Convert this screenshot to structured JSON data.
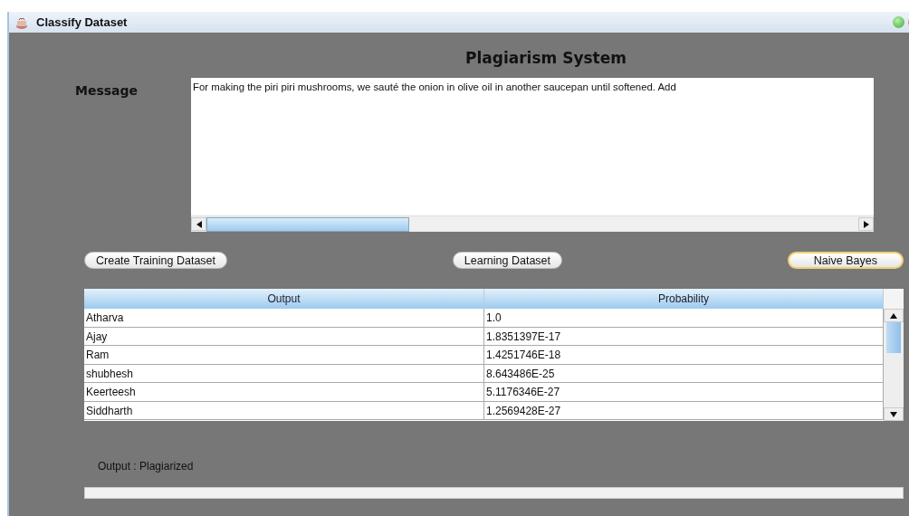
{
  "window": {
    "title": "Classify Dataset"
  },
  "heading": "Plagiarism System",
  "message": {
    "label": "Message",
    "value": "For making the piri piri mushrooms, we sauté the onion in olive oil in another saucepan until softened. Add"
  },
  "buttons": [
    {
      "label": "Create Training Dataset",
      "focused": false
    },
    {
      "label": "Learning Dataset",
      "focused": false
    },
    {
      "label": "Naive Bayes",
      "focused": true
    }
  ],
  "table": {
    "columns": [
      "Output",
      "Probability"
    ],
    "rows": [
      [
        "Atharva",
        "1.0"
      ],
      [
        "Ajay",
        "1.8351397E-17"
      ],
      [
        "Ram",
        "1.4251746E-18"
      ],
      [
        "shubhesh",
        "8.643486E-25"
      ],
      [
        "Keerteesh",
        "5.1176346E-27"
      ],
      [
        "Siddharth",
        "1.2569428E-27"
      ]
    ]
  },
  "result": "Output : Plagiarized"
}
